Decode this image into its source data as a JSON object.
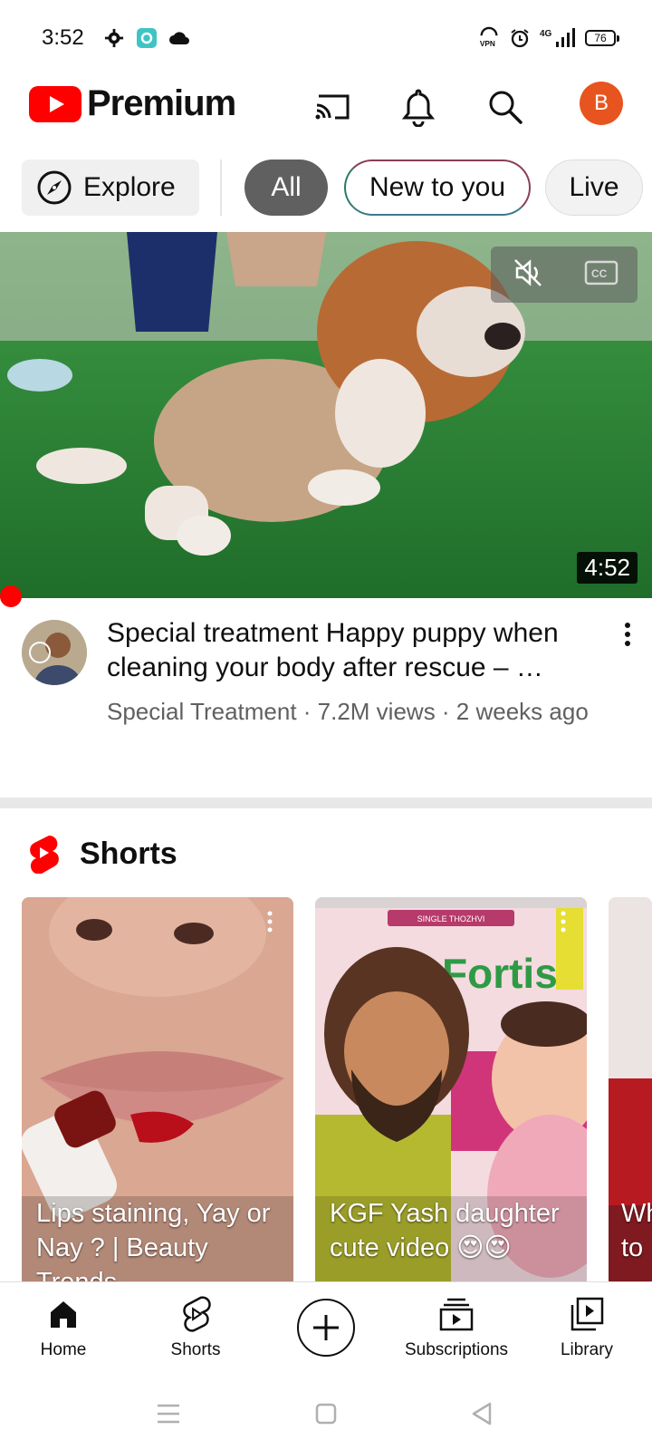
{
  "status_bar": {
    "time": "3:52",
    "network": "4G",
    "vpn": "VPN",
    "battery": "76"
  },
  "header": {
    "logo_text": "Premium",
    "avatar_letter": "B",
    "colors": {
      "brand_red": "#ff0000",
      "avatar_bg": "#e8541f"
    }
  },
  "chips": {
    "explore": "Explore",
    "items": [
      "All",
      "New to you",
      "Live"
    ],
    "selected": "All"
  },
  "video": {
    "duration": "4:52",
    "title": "Special treatment Happy puppy when cleaning your body after rescue – …",
    "channel": "Special Treatment",
    "views": "7.2M views",
    "age": "2 weeks ago",
    "subtitle": "Special Treatment · 7.2M views · 2 weeks ago",
    "controls": [
      "mute-icon",
      "captions-icon"
    ]
  },
  "shorts": {
    "title": "Shorts",
    "items": [
      {
        "caption": "Lips staining, Yay or Nay ? | Beauty Trends"
      },
      {
        "caption": "KGF Yash daughter cute video 😍😍",
        "overlay_text": "Fortis",
        "badge": "SINGLE THOZHVI"
      },
      {
        "caption": "Wh to"
      }
    ]
  },
  "bottom_nav": {
    "items": [
      "Home",
      "Shorts",
      "Subscriptions",
      "Library"
    ],
    "active": "Home"
  }
}
